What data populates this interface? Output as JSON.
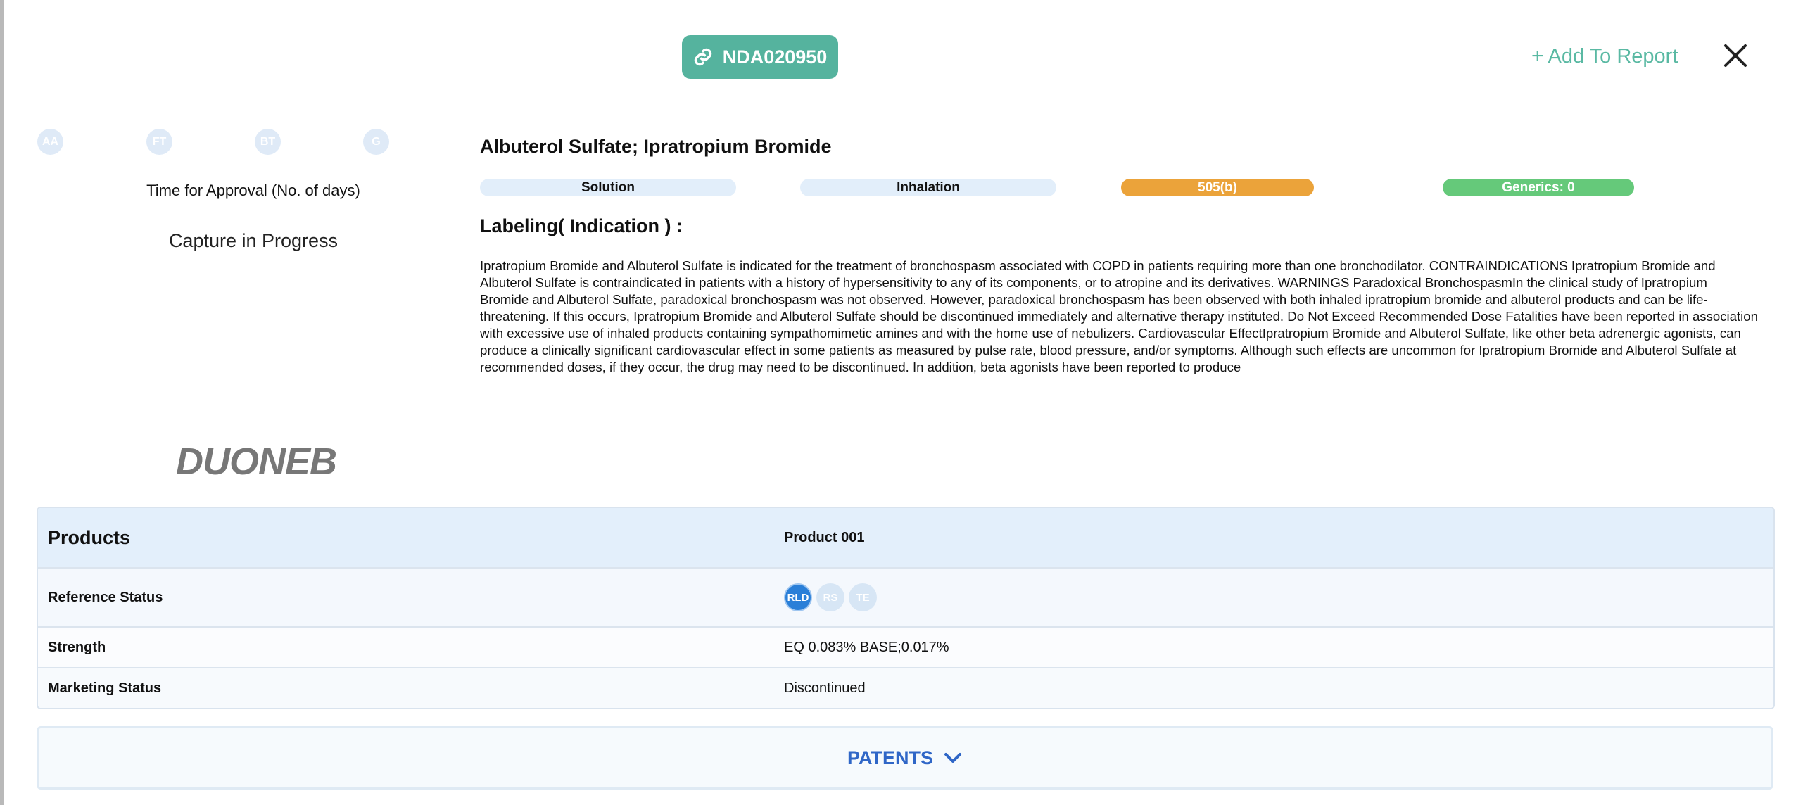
{
  "header": {
    "application_number": "NDA020950",
    "add_to_report_label": "Add To Report"
  },
  "reviewers": [
    "AA",
    "FT",
    "BT",
    "G"
  ],
  "approval": {
    "label": "Time for Approval (No. of days)",
    "value": "Capture in Progress"
  },
  "brand_name": "DUONEB",
  "drug": {
    "title": "Albuterol Sulfate; Ipratropium Bromide",
    "tags": {
      "dosage_form": "Solution",
      "route": "Inhalation",
      "pathway": "505(b)",
      "generics": "Generics: 0"
    },
    "labeling_title": "Labeling( Indication ) :",
    "labeling_text": "Ipratropium Bromide and Albuterol Sulfate is indicated for the treatment of bronchospasm associated with COPD in patients requiring more than one bronchodilator. CONTRAINDICATIONS Ipratropium Bromide and Albuterol Sulfate is contraindicated in patients with a history of hypersensitivity to any of its components, or to atropine and its derivatives. WARNINGS Paradoxical BronchospasmIn the clinical study of Ipratropium Bromide and Albuterol Sulfate, paradoxical bronchospasm was not observed. However, paradoxical bronchospasm has been observed with both inhaled ipratropium bromide and albuterol products and can be life-threatening. If this occurs, Ipratropium Bromide and Albuterol Sulfate should be discontinued immediately and alternative therapy instituted. Do Not Exceed Recommended Dose  Fatalities have been reported in association with excessive use of inhaled products containing sympathomimetic amines and with the home use of nebulizers. Cardiovascular EffectIpratropium Bromide and Albuterol Sulfate, like other beta adrenergic agonists, can produce a clinically significant cardiovascular effect in some patients as measured by pulse rate, blood pressure, and/or symptoms. Although such effects are uncommon for Ipratropium Bromide and Albuterol Sulfate at recommended doses, if they occur, the drug may need to be discontinued. In addition, beta agonists have been reported to produce"
  },
  "products": {
    "header_label": "Products",
    "product_name": "Product 001",
    "reference_status_label": "Reference Status",
    "reference_status_icons": [
      "RLD",
      "RS",
      "TE"
    ],
    "strength_label": "Strength",
    "strength_value": "EQ 0.083% BASE;0.017%",
    "marketing_status_label": "Marketing Status",
    "marketing_status_value": "Discontinued"
  },
  "patents_label": "PATENTS",
  "colors": {
    "accent_teal": "#55b39e",
    "pathway_orange": "#eba33a",
    "generics_green": "#65c97a",
    "rld_blue": "#2a7fd8",
    "patents_blue": "#2f66c7"
  }
}
